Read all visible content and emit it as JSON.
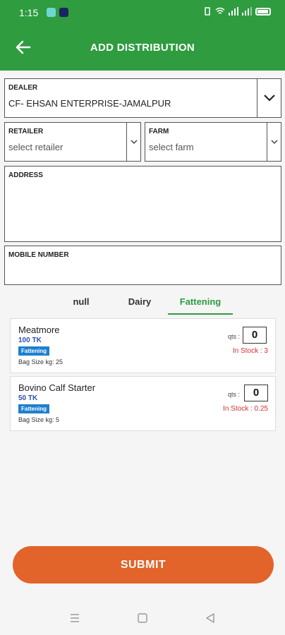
{
  "status_bar": {
    "time": "1:15"
  },
  "header": {
    "title": "ADD DISTRIBUTION"
  },
  "dealer": {
    "label": "DEALER",
    "value": "CF- EHSAN ENTERPRISE-JAMALPUR"
  },
  "retailer": {
    "label": "RETAILER",
    "placeholder": "select retailer"
  },
  "farm": {
    "label": "FARM",
    "placeholder": "select farm"
  },
  "address": {
    "label": "ADDRESS"
  },
  "mobile": {
    "label": "MOBILE NUMBER"
  },
  "tabs": [
    {
      "label": "null"
    },
    {
      "label": "Dairy"
    },
    {
      "label": "Fattening",
      "active": true
    }
  ],
  "products": [
    {
      "name": "Meatmore",
      "price": "100 TK",
      "badge": "Fattening",
      "bag_size": "Bag Size kg: 25",
      "qts_label": "qts :",
      "qty": "0",
      "stock": "In Stock : 3"
    },
    {
      "name": "Bovino Calf Starter",
      "price": "50 TK",
      "badge": "Fattening",
      "bag_size": "Bag Size kg: 5",
      "qts_label": "qts :",
      "qty": "0",
      "stock": "In Stock : 0.25"
    }
  ],
  "submit_label": "SUBMIT",
  "colors": {
    "primary": "#2e9c3f",
    "accent": "#e2642a",
    "price": "#2b4fb0",
    "badge": "#1e7fce",
    "stock": "#d32f2f"
  }
}
